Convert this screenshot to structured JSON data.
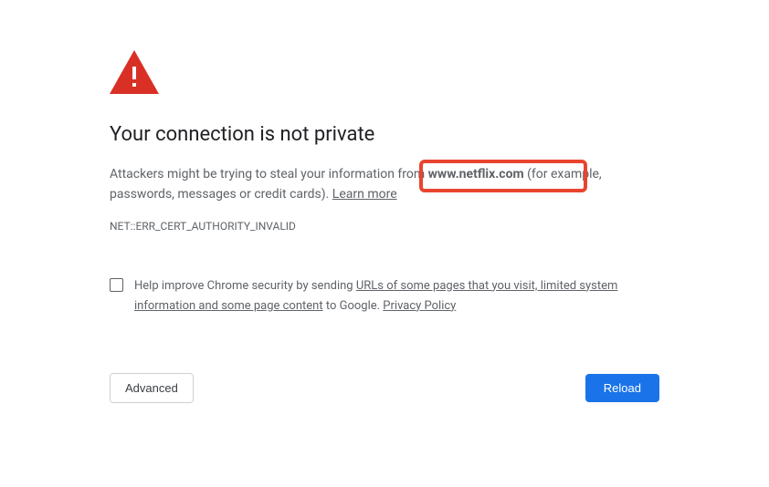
{
  "heading": "Your connection is not private",
  "description": {
    "prefix": "Attackers might be trying to steal your information from ",
    "domain": "www.netflix.com",
    "suffix": " (for example, passwords, messages or credit cards). ",
    "learn_more": "Learn more"
  },
  "error_code": "NET::ERR_CERT_AUTHORITY_INVALID",
  "opt_in": {
    "prefix": "Help improve Chrome security by sending ",
    "link1": "URLs of some pages that you visit, limited system information and some page content",
    "middle": " to Google. ",
    "link2": "Privacy Policy"
  },
  "buttons": {
    "advanced": "Advanced",
    "reload": "Reload"
  }
}
